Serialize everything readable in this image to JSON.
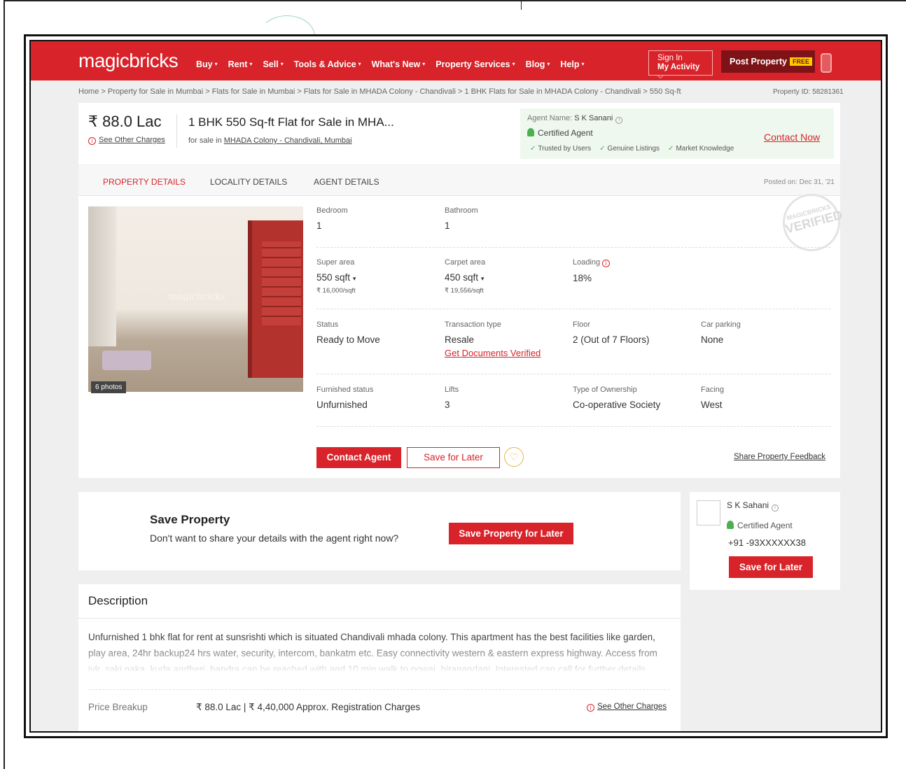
{
  "header": {
    "logo": "magicbricks",
    "nav": [
      "Buy",
      "Rent",
      "Sell",
      "Tools & Advice",
      "What's New",
      "Property Services",
      "Blog",
      "Help"
    ],
    "sign_in": "Sign In",
    "my_activity": "My Activity",
    "post_property": "Post Property",
    "free_badge": "FREE"
  },
  "breadcrumb": "Home  >  Property for Sale in Mumbai  >  Flats for Sale in Mumbai  >  Flats for Sale in MHADA Colony - Chandivali  >  1 BHK Flats for Sale in MHADA Colony - Chandivali  > 550 Sq-ft",
  "property_id": "Property ID: 58281361",
  "summary": {
    "price": "₹ 88.0 Lac",
    "other_charges": "See Other Charges",
    "title": "1 BHK 550 Sq-ft Flat for Sale in MHA...",
    "for_sale_prefix": "for sale in",
    "location_link": "MHADA Colony - Chandivali, Mumbai"
  },
  "agent": {
    "name_label": "Agent Name:",
    "name": "S K Sanani",
    "certified": "Certified Agent",
    "trust": [
      "Trusted by Users",
      "Genuine Listings",
      "Market Knowledge"
    ],
    "contact_now": "Contact Now"
  },
  "tabs": [
    "PROPERTY DETAILS",
    "LOCALITY DETAILS",
    "AGENT DETAILS"
  ],
  "posted_on": "Posted on: Dec 31, '21",
  "photo": {
    "watermark": "magicbricks",
    "count": "6 photos"
  },
  "stamp": {
    "line1": "MAGICBRICKS",
    "line2": "VERIFIED"
  },
  "details": {
    "bedroom": {
      "label": "Bedroom",
      "value": "1"
    },
    "bathroom": {
      "label": "Bathroom",
      "value": "1"
    },
    "super_area": {
      "label": "Super area",
      "value": "550 sqft",
      "sub": "₹ 16,000/sqft"
    },
    "carpet_area": {
      "label": "Carpet area",
      "value": "450 sqft",
      "sub": "₹ 19,556/sqft"
    },
    "loading": {
      "label": "Loading",
      "value": "18%"
    },
    "status": {
      "label": "Status",
      "value": "Ready to Move"
    },
    "transaction": {
      "label": "Transaction type",
      "value": "Resale",
      "link": "Get Documents Verified"
    },
    "floor": {
      "label": "Floor",
      "value": "2 (Out of 7 Floors)"
    },
    "car_parking": {
      "label": "Car parking",
      "value": "None"
    },
    "furnished": {
      "label": "Furnished status",
      "value": "Unfurnished"
    },
    "lifts": {
      "label": "Lifts",
      "value": "3"
    },
    "ownership": {
      "label": "Type of Ownership",
      "value": "Co-operative Society"
    },
    "facing": {
      "label": "Facing",
      "value": "West"
    }
  },
  "actions": {
    "contact_agent": "Contact Agent",
    "save_for_later": "Save for Later",
    "share_feedback": "Share Property Feedback"
  },
  "save_property": {
    "title": "Save Property",
    "subtitle": "Don't want to share your details with the agent right now?",
    "button": "Save Property for Later"
  },
  "side_agent": {
    "name": "S K Sahani",
    "certified": "Certified Agent",
    "phone": "+91 -93XXXXXX38",
    "button": "Save for Later"
  },
  "description": {
    "title": "Description",
    "text": "Unfurnished 1 bhk flat for rent at sunsrishti which is situated Chandivali mhada colony. This apartment has the best facilities like garden, play area, 24hr backup24 hrs water, security, intercom, bankatm etc. Easy connectivity western & eastern express highway. Access from jvlr, saki naka, kurla andheri, bandra can be reached with and 10 min walk to powai, hiranandani. Interested can call for further details",
    "price_breakup_label": "Price Breakup",
    "price_breakup_value": "₹ 88.0 Lac  |  ₹ 4,40,000 Approx. Registration Charges",
    "other_charges": "See Other Charges"
  },
  "colors": {
    "brand_red": "#d8232a",
    "dark_red": "#7d1317",
    "certified_green": "#4caf50"
  }
}
